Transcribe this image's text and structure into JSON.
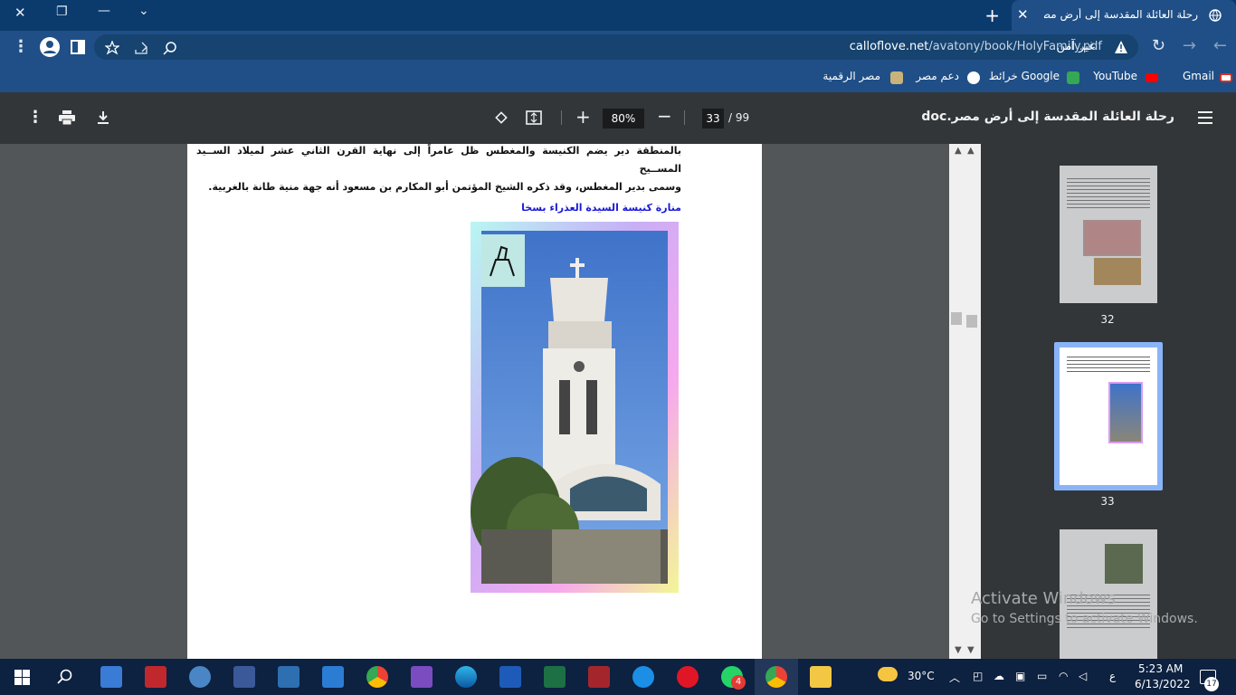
{
  "tab": {
    "title": "رحلة العائلة المقدسة إلى أرض مصر",
    "close": "✕"
  },
  "window": {
    "new_tab": "+",
    "minimize": "—",
    "restore": "❐",
    "close": "✕",
    "chevron": "⌄"
  },
  "address": {
    "security": "غير آمن",
    "domain": "calloflove.net",
    "path": "/avatony/book/HolyFamily.pdf"
  },
  "bookmarks": [
    {
      "label": "Gmail",
      "color": "#d93025"
    },
    {
      "label": "YouTube",
      "color": "#ff0000"
    },
    {
      "label": "خرائط Google",
      "color": "#34a853"
    },
    {
      "label": "دعم مصر",
      "color": "#ffffff"
    },
    {
      "label": "مصر الرقمية",
      "color": "#c9b37a"
    }
  ],
  "pdf": {
    "title": "رحلة العائلة المقدسة إلى أرض مصر.doc",
    "zoom": "80%",
    "page": "33",
    "total": "/ 99",
    "text_lines": [
      "بالمنطقة دير يضم الكنيسة والمغطس ظل عامراً إلى نهاية القرن الثاني عشر لميلاد الســيد المســيح",
      "وسمى بدير المغطس، وقد ذكره الشيخ المؤتمن أبو المكارم بن مسعود أنه جهة منية طانة بالغربية."
    ],
    "caption": "منارة كنيسة السيدة العذراء بسخا",
    "thumbnails": [
      "32",
      "33"
    ]
  },
  "watermark": {
    "line1": "Activate Windows",
    "line2": "Go to Settings to activate Windows."
  },
  "taskbar": {
    "weather": "30°C",
    "time": "5:23 AM",
    "date": "6/13/2022",
    "lang": "ع",
    "notifications": "17",
    "whatsapp_badge": "4"
  },
  "colors": {
    "tabbar": "#0b3a6d",
    "toolbar": "#1f4f86",
    "pdf_toolbar": "#323639",
    "viewer": "#525659",
    "caption": "#1a1ad6"
  }
}
